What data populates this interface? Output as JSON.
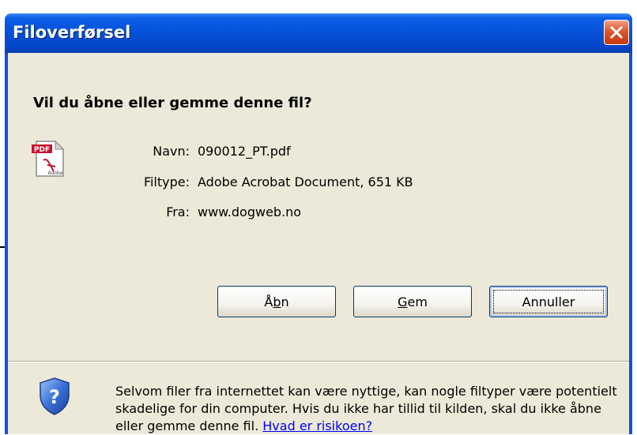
{
  "window": {
    "title": "Filoverførsel",
    "close_icon": "close-icon"
  },
  "dialog": {
    "question": "Vil du åbne eller gemme denne fil?",
    "file_icon": "pdf-file-icon",
    "file_icon_badge": "PDF",
    "file_icon_brand": "Adobe",
    "info": {
      "name_label": "Navn:",
      "name_value": "090012_PT.pdf",
      "type_label": "Filtype:",
      "type_value": "Adobe Acrobat Document, 651 KB",
      "from_label": "Fra:",
      "from_value": "www.dogweb.no"
    },
    "buttons": {
      "open": {
        "prefix": "Å",
        "mnemonic": "b",
        "suffix": "n"
      },
      "save": {
        "prefix": "",
        "mnemonic": "G",
        "suffix": "em"
      },
      "cancel": {
        "label": "Annuller"
      }
    },
    "warning": {
      "icon": "shield-question-icon",
      "text": "Selvom filer fra internettet kan være nyttige, kan nogle filtyper være potentielt skadelige for din computer. Hvis du ikke har tillid til kilden, skal du ikke åbne eller gemme denne fil.",
      "link": "Hvad er risikoen?"
    }
  },
  "annotation": {
    "arrow_icon": "arrow-right-icon"
  },
  "colors": {
    "titlebar": "#0a5ee6",
    "client": "#ece9d8",
    "link": "#0000ff",
    "close": "#e0562c"
  }
}
